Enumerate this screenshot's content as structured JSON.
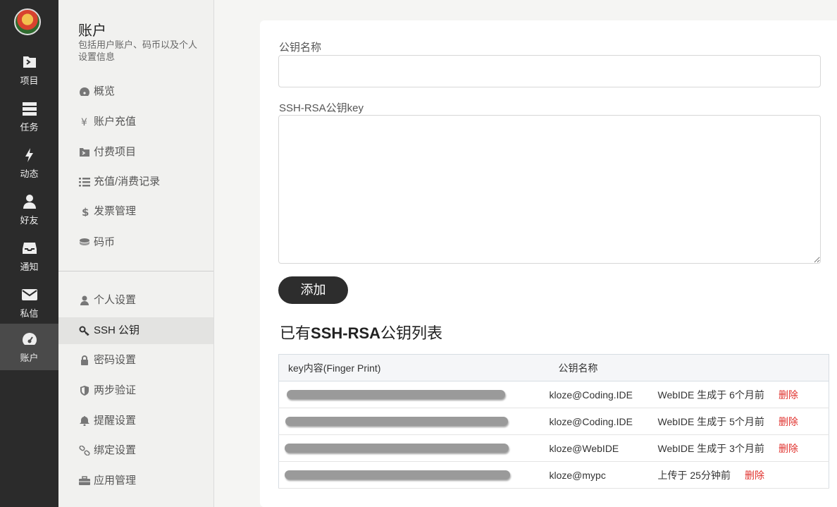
{
  "rail": {
    "items": [
      {
        "label": "项目",
        "icon": "project-icon"
      },
      {
        "label": "任务",
        "icon": "task-icon"
      },
      {
        "label": "动态",
        "icon": "bolt-icon"
      },
      {
        "label": "好友",
        "icon": "user-icon"
      },
      {
        "label": "通知",
        "icon": "inbox-icon"
      },
      {
        "label": "私信",
        "icon": "envelope-icon"
      },
      {
        "label": "账户",
        "icon": "dashboard-icon",
        "active": true
      }
    ]
  },
  "sidebar": {
    "title": "账户",
    "description": "包括用户账户、码币以及个人设置信息",
    "groups": [
      [
        {
          "label": "概览",
          "icon": "dashboard-icon"
        },
        {
          "label": "账户充值",
          "icon": "yen-icon"
        },
        {
          "label": "付费项目",
          "icon": "project-icon"
        },
        {
          "label": "充值/消费记录",
          "icon": "list-icon"
        },
        {
          "label": "发票管理",
          "icon": "dollar-icon"
        },
        {
          "label": "码币",
          "icon": "coins-icon"
        }
      ],
      [
        {
          "label": "个人设置",
          "icon": "user-icon"
        },
        {
          "label": "SSH 公钥",
          "icon": "key-icon",
          "active": true
        },
        {
          "label": "密码设置",
          "icon": "lock-icon"
        },
        {
          "label": "两步验证",
          "icon": "shield-icon"
        },
        {
          "label": "提醒设置",
          "icon": "bell-icon"
        },
        {
          "label": "绑定设置",
          "icon": "link-icon"
        },
        {
          "label": "应用管理",
          "icon": "briefcase-icon"
        }
      ]
    ]
  },
  "form": {
    "name_label": "公钥名称",
    "name_value": "",
    "key_label": "SSH-RSA公钥key",
    "key_value": "",
    "add_button": "添加"
  },
  "list": {
    "title_prefix": "已有",
    "title_bold": "SSH-RSA",
    "title_suffix": "公钥列表",
    "headers": [
      "key内容(Finger Print)",
      "公钥名称"
    ],
    "rows": [
      {
        "name": "kloze@Coding.IDE",
        "meta": "WebIDE 生成于 6个月前",
        "action": "删除"
      },
      {
        "name": "kloze@Coding.IDE",
        "meta": "WebIDE 生成于 5个月前",
        "action": "删除"
      },
      {
        "name": "kloze@WebIDE",
        "meta": "WebIDE 生成于 3个月前",
        "action": "删除"
      },
      {
        "name": "kloze@mypc",
        "meta": "上传于 25分钟前",
        "action": "删除"
      }
    ]
  },
  "colors": {
    "rail_bg": "#2b2b2b",
    "delete": "#e0312d",
    "button": "#2d2d2d"
  }
}
